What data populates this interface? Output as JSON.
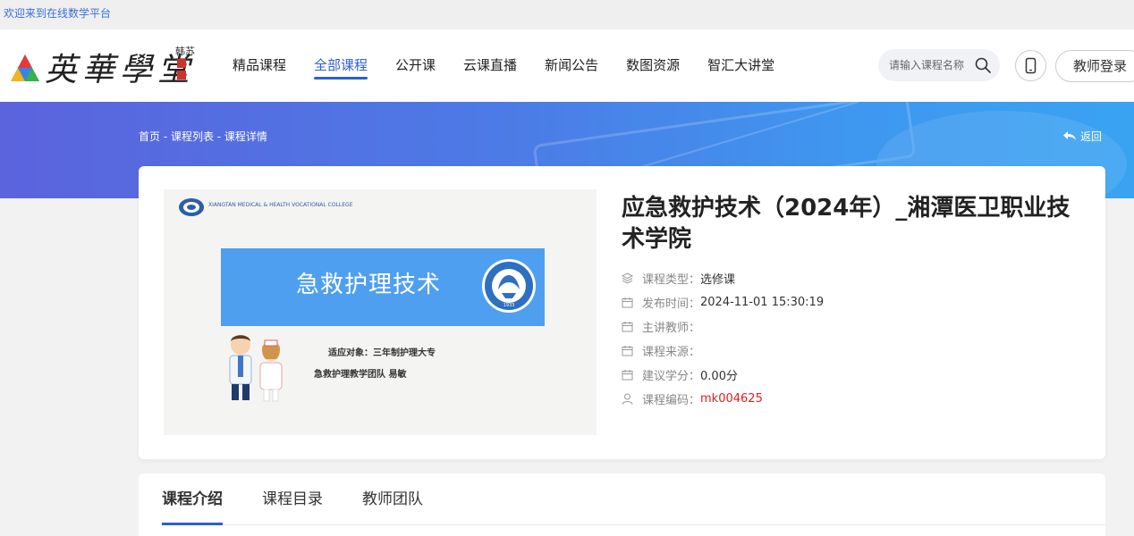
{
  "topbar": {
    "welcome": "欢迎来到在线数学平台"
  },
  "header": {
    "logo_text": "英華學堂",
    "logo_sub": "英华学堂",
    "logo_side": "韩苏",
    "nav": [
      {
        "label": "精品课程",
        "active": false
      },
      {
        "label": "全部课程",
        "active": true
      },
      {
        "label": "公开课",
        "active": false
      },
      {
        "label": "云课直播",
        "active": false
      },
      {
        "label": "新闻公告",
        "active": false
      },
      {
        "label": "数图资源",
        "active": false
      },
      {
        "label": "智汇大讲堂",
        "active": false
      }
    ],
    "search": {
      "placeholder": "请输入课程名称",
      "icon": "search-icon"
    },
    "phone_icon": "mobile-phone-icon",
    "login_label": "教师登录"
  },
  "banner": {
    "breadcrumb": "首页 - 课程列表 - 课程详情",
    "back_label": "返回",
    "back_icon": "reply-arrow-icon"
  },
  "course": {
    "title": "应急救护技术（2024年）_湘潭医卫职业技术学院",
    "cover": {
      "panel_title": "急救护理技术",
      "audience": "适应对象：三年制护理大专",
      "team": "急救护理教学团队    易敏",
      "emblem_year": "1933"
    },
    "meta": [
      {
        "icon": "layers-icon",
        "label": "课程类型：",
        "value": "选修课",
        "highlight": false
      },
      {
        "icon": "calendar-icon",
        "label": "发布时间：",
        "value": "2024-11-01 15:30:19",
        "highlight": false
      },
      {
        "icon": "calendar-icon",
        "label": "主讲教师：",
        "value": "",
        "highlight": false
      },
      {
        "icon": "calendar-icon",
        "label": "课程来源：",
        "value": "",
        "highlight": false
      },
      {
        "icon": "calendar-icon",
        "label": "建议学分：",
        "value": "0.00分",
        "highlight": false
      },
      {
        "icon": "user-icon",
        "label": "课程编码：",
        "value": "mk004625",
        "highlight": true
      }
    ]
  },
  "tabs": [
    {
      "label": "课程介绍",
      "active": true
    },
    {
      "label": "课程目录",
      "active": false
    },
    {
      "label": "教师团队",
      "active": false
    }
  ],
  "colors": {
    "accent": "#2c5fd6",
    "highlight": "#e02020",
    "banner_start": "#5b63dd",
    "banner_end": "#39a3f2"
  }
}
